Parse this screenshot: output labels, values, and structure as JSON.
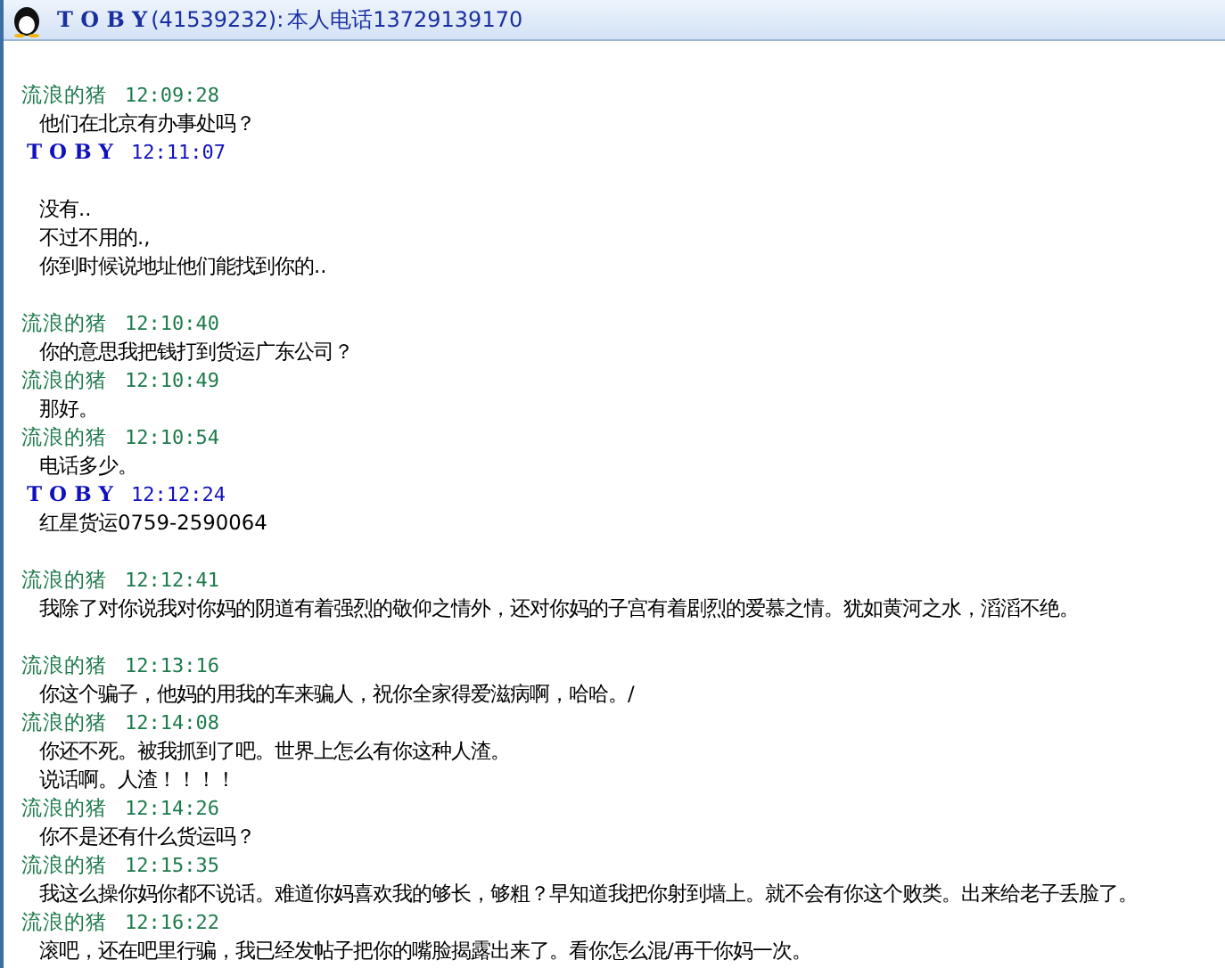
{
  "header": {
    "name": "T O B Y",
    "number": "(41539232):",
    "note": "本人电话13729139170"
  },
  "blocks": [
    {
      "messages": [
        {
          "sender": "流浪的猪",
          "kind": "other",
          "time": "12:09:28",
          "spaced": false,
          "lines": [
            "他们在北京有办事处吗？"
          ]
        },
        {
          "sender": "T O B Y",
          "kind": "self",
          "time": "12:11:07",
          "spaced": true,
          "lines": [
            "没有..",
            "不过不用的.,",
            "你到时候说地址他们能找到你的.."
          ]
        }
      ]
    },
    {
      "messages": [
        {
          "sender": "流浪的猪",
          "kind": "other",
          "time": "12:10:40",
          "spaced": false,
          "lines": [
            "你的意思我把钱打到货运广东公司？"
          ]
        },
        {
          "sender": "流浪的猪",
          "kind": "other",
          "time": "12:10:49",
          "spaced": false,
          "lines": [
            "那好。"
          ]
        },
        {
          "sender": "流浪的猪",
          "kind": "other",
          "time": "12:10:54",
          "spaced": false,
          "lines": [
            "电话多少。"
          ]
        },
        {
          "sender": "T O B Y",
          "kind": "self",
          "time": "12:12:24",
          "spaced": false,
          "lines": [
            "红星货运0759-2590064"
          ]
        }
      ]
    },
    {
      "messages": [
        {
          "sender": "流浪的猪",
          "kind": "other",
          "time": "12:12:41",
          "spaced": false,
          "lines": [
            "我除了对你说我对你妈的阴道有着强烈的敬仰之情外，还对你妈的子宫有着剧烈的爱慕之情。犹如黄河之水，滔滔不绝。"
          ]
        }
      ]
    },
    {
      "messages": [
        {
          "sender": "流浪的猪",
          "kind": "other",
          "time": "12:13:16",
          "spaced": false,
          "lines": [
            "你这个骗子，他妈的用我的车来骗人，祝你全家得爱滋病啊，哈哈。/"
          ]
        },
        {
          "sender": "流浪的猪",
          "kind": "other",
          "time": "12:14:08",
          "spaced": false,
          "lines": [
            "你还不死。被我抓到了吧。世界上怎么有你这种人渣。",
            "说话啊。人渣！！！！"
          ]
        },
        {
          "sender": "流浪的猪",
          "kind": "other",
          "time": "12:14:26",
          "spaced": false,
          "lines": [
            "你不是还有什么货运吗？"
          ]
        },
        {
          "sender": "流浪的猪",
          "kind": "other",
          "time": "12:15:35",
          "spaced": false,
          "lines": [
            "我这么操你妈你都不说话。难道你妈喜欢我的够长，够粗？早知道我把你射到墙上。就不会有你这个败类。出来给老子丢脸了。"
          ]
        },
        {
          "sender": "流浪的猪",
          "kind": "other",
          "time": "12:16:22",
          "spaced": false,
          "lines": [
            "滚吧，还在吧里行骗，我已经发帖子把你的嘴脸揭露出来了。看你怎么混/再干你妈一次。"
          ]
        }
      ]
    }
  ]
}
